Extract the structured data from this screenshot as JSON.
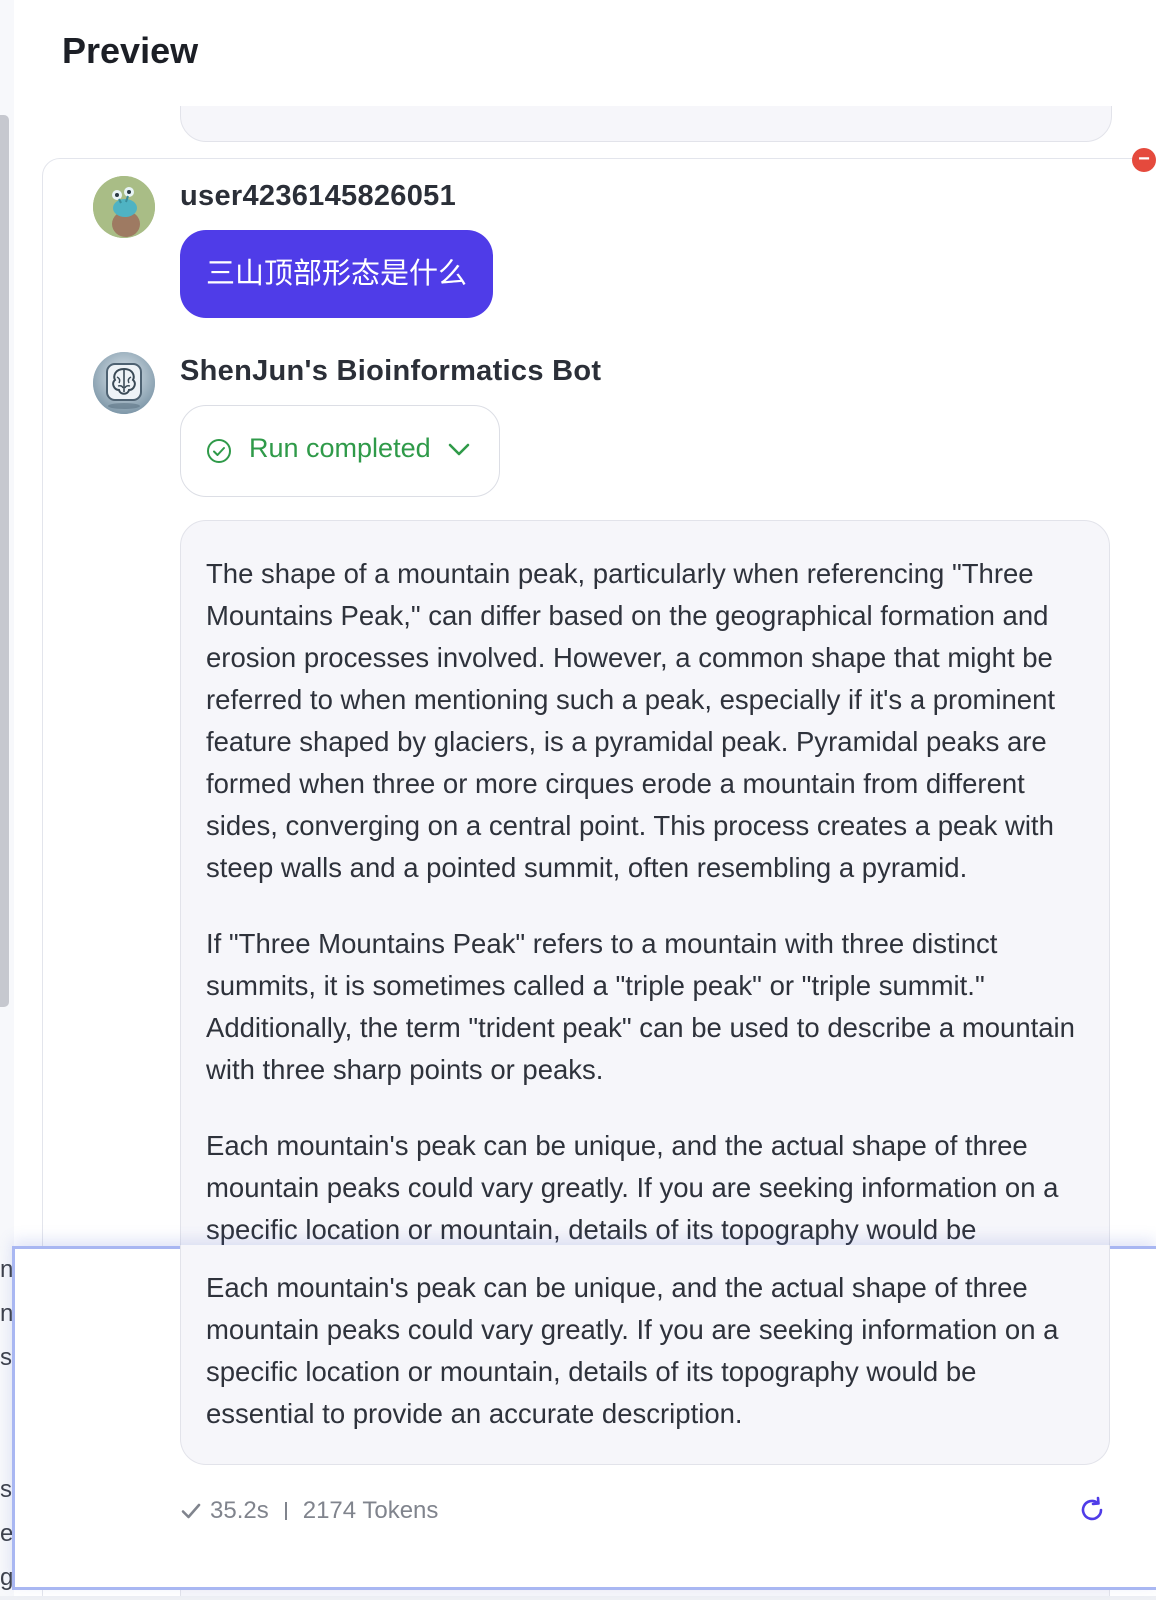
{
  "panel": {
    "title": "Preview"
  },
  "messages": {
    "user": {
      "name": "user4236145826051",
      "text": "三山顶部形态是什么"
    },
    "bot": {
      "name": "ShenJun's Bioinformatics Bot",
      "status": "Run completed",
      "paragraphs": [
        "The shape of a mountain peak, particularly when referencing \"Three Mountains Peak,\" can differ based on the geographical formation and erosion processes involved. However, a common shape that might be referred to when mentioning such a peak, especially if it's a prominent feature shaped by glaciers, is a pyramidal peak. Pyramidal peaks are formed when three or more cirques erode a mountain from different sides, converging on a central point. This process creates a peak with steep walls and a pointed summit, often resembling a pyramid.",
        "If \"Three Mountains Peak\" refers to a mountain with three distinct summits, it is sometimes called a \"triple peak\" or \"triple summit.\" Additionally, the term \"trident peak\" can be used to describe a mountain with three sharp points or peaks.",
        "Each mountain's peak can be unique, and the actual shape of three mountain peaks could vary greatly. If you are seeking information on a specific location or mountain, details of its topography would be essential to provide an accurate description."
      ]
    }
  },
  "meta": {
    "duration": "35.2s",
    "tokens": "2174 Tokens"
  },
  "icons": {
    "status": "check-circle-icon",
    "expand": "chevron-down-icon",
    "meta": "checkmark-icon",
    "refresh": "refresh-icon",
    "delete": "close-icon"
  },
  "colors": {
    "user_bubble": "#4f3ce8",
    "status_green": "#2f9a49",
    "bubble_bg": "#f6f6fa",
    "delete_red": "#e54a3d"
  }
}
